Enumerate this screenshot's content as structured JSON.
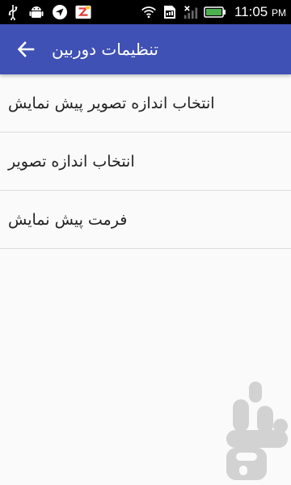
{
  "status_bar": {
    "time": "11:05",
    "time_suffix": "PM",
    "icons": [
      "usb-icon",
      "android-icon",
      "navigation-icon",
      "app-notification-icon",
      "wifi-icon",
      "sdcard-icon",
      "no-signal-icon",
      "battery-icon"
    ]
  },
  "toolbar": {
    "title": "تنظیمات دوربین",
    "back_icon": "arrow-left-icon",
    "color": "#3f51b5"
  },
  "settings": {
    "items": [
      {
        "label": "انتخاب اندازه تصویر پیش نمایش"
      },
      {
        "label": "انتخاب اندازه تصویر"
      },
      {
        "label": "فرمت پیش نمایش"
      }
    ]
  },
  "watermark": {
    "icon": "bazaar-logo-icon"
  }
}
